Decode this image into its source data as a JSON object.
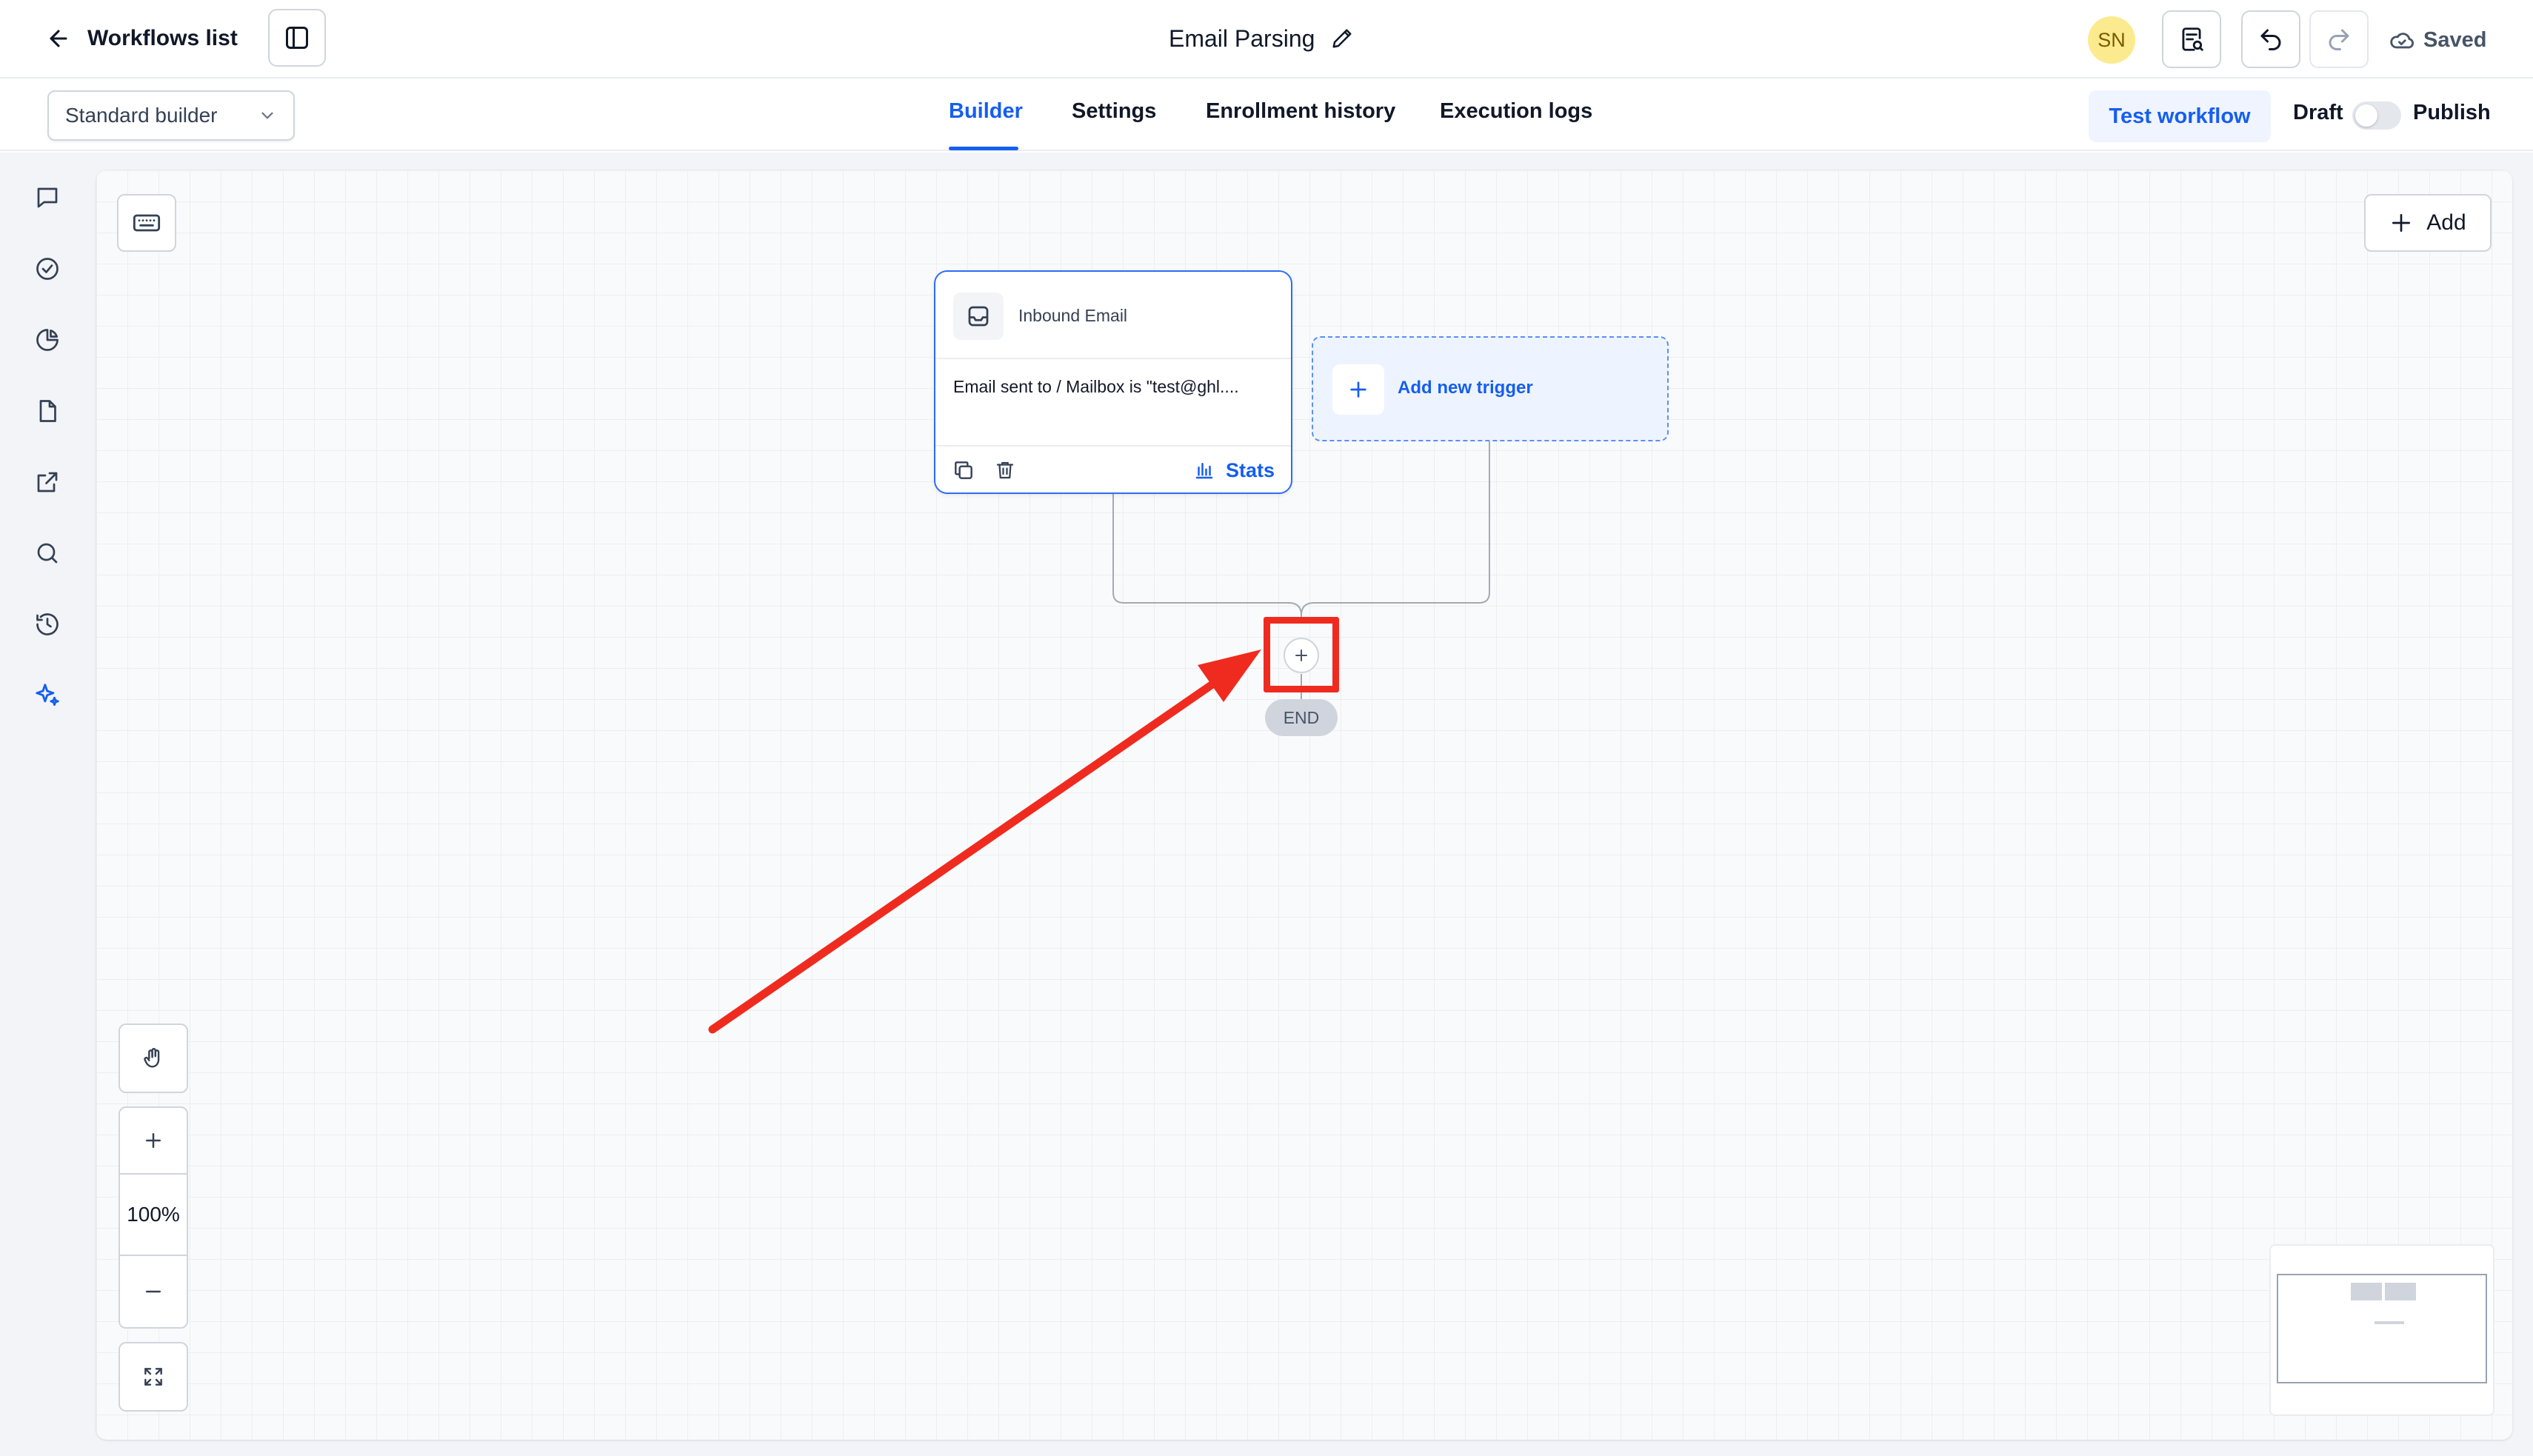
{
  "header": {
    "back_label": "Workflows list",
    "workflow_name": "Email Parsing",
    "avatar_initials": "SN",
    "saved_label": "Saved"
  },
  "subheader": {
    "builder_mode": "Standard builder",
    "tabs": [
      {
        "label": "Builder",
        "active": true
      },
      {
        "label": "Settings",
        "active": false
      },
      {
        "label": "Enrollment history",
        "active": false
      },
      {
        "label": "Execution logs",
        "active": false
      }
    ],
    "test_button": "Test workflow",
    "draft_label": "Draft",
    "publish_label": "Publish",
    "publish_enabled": false
  },
  "rail": {
    "items": [
      {
        "icon": "chat-icon"
      },
      {
        "icon": "check-circle-icon"
      },
      {
        "icon": "pie-chart-icon"
      },
      {
        "icon": "file-icon"
      },
      {
        "icon": "external-link-icon"
      },
      {
        "icon": "search-icon"
      },
      {
        "icon": "history-icon"
      },
      {
        "icon": "sparkles-icon",
        "active": true
      }
    ]
  },
  "canvas": {
    "add_label": "Add",
    "trigger": {
      "title": "Inbound Email",
      "condition": "Email sent to / Mailbox is \"test@ghl....",
      "stats_label": "Stats"
    },
    "new_trigger_label": "Add new trigger",
    "end_label": "END",
    "zoom_level": "100%"
  },
  "colors": {
    "accent": "#155eef",
    "annotation": "#ef2b20",
    "avatar_bg": "#fcea8f"
  }
}
